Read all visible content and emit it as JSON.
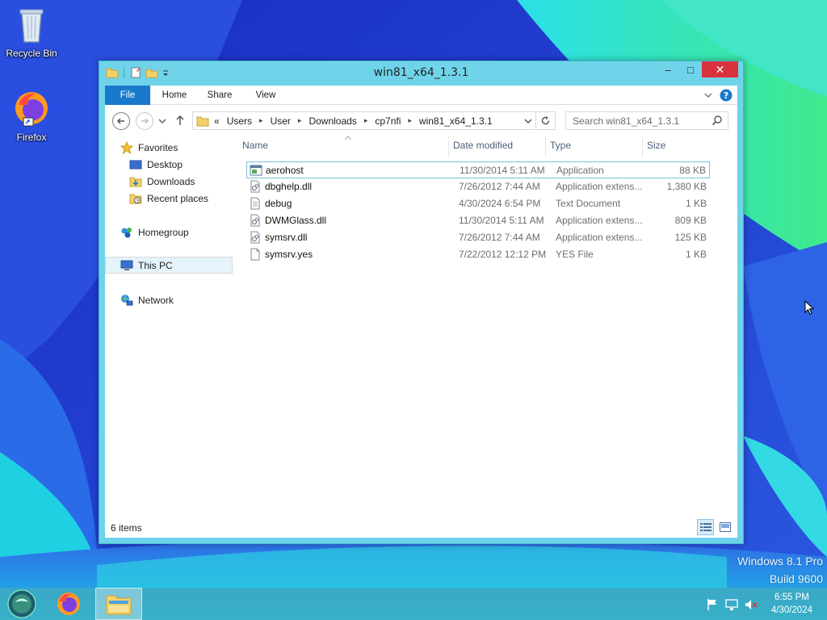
{
  "desktop": {
    "icons": [
      {
        "label": "Recycle Bin",
        "icon": "recycle-bin-icon"
      },
      {
        "label": "Firefox",
        "icon": "firefox-icon"
      }
    ],
    "watermark": {
      "line1": "Windows 8.1 Pro",
      "line2": "Build 9600"
    }
  },
  "window": {
    "title": "win81_x64_1.3.1",
    "caption": {
      "minimize": "–",
      "maximize": "□",
      "close": "✕"
    },
    "ribbon": {
      "tabs": [
        "File",
        "Home",
        "Share",
        "View"
      ],
      "accent": "#1979ca"
    },
    "address": {
      "prefix": "«",
      "crumbs": [
        "Users",
        "User",
        "Downloads",
        "cp7nfi",
        "win81_x64_1.3.1"
      ]
    },
    "search": {
      "placeholder": "Search win81_x64_1.3.1"
    },
    "nav": {
      "favorites": "Favorites",
      "favorites_items": [
        "Desktop",
        "Downloads",
        "Recent places"
      ],
      "homegroup": "Homegroup",
      "thispc": "This PC",
      "network": "Network"
    },
    "columns": [
      "Name",
      "Date modified",
      "Type",
      "Size"
    ],
    "files": [
      {
        "name": "aerohost",
        "date": "11/30/2014 5:11 AM",
        "type": "Application",
        "size": "88 KB",
        "icon": "application-icon"
      },
      {
        "name": "dbghelp.dll",
        "date": "7/26/2012 7:44 AM",
        "type": "Application extens...",
        "size": "1,380 KB",
        "icon": "dll-icon"
      },
      {
        "name": "debug",
        "date": "4/30/2024 6:54 PM",
        "type": "Text Document",
        "size": "1 KB",
        "icon": "text-document-icon"
      },
      {
        "name": "DWMGlass.dll",
        "date": "11/30/2014 5:11 AM",
        "type": "Application extens...",
        "size": "809 KB",
        "icon": "dll-icon"
      },
      {
        "name": "symsrv.dll",
        "date": "7/26/2012 7:44 AM",
        "type": "Application extens...",
        "size": "125 KB",
        "icon": "dll-icon"
      },
      {
        "name": "symsrv.yes",
        "date": "7/22/2012 12:12 PM",
        "type": "YES File",
        "size": "1 KB",
        "icon": "file-icon"
      }
    ],
    "status": "6 items"
  },
  "taskbar": {
    "clock": {
      "time": "6:55 PM",
      "date": "4/30/2024"
    }
  }
}
